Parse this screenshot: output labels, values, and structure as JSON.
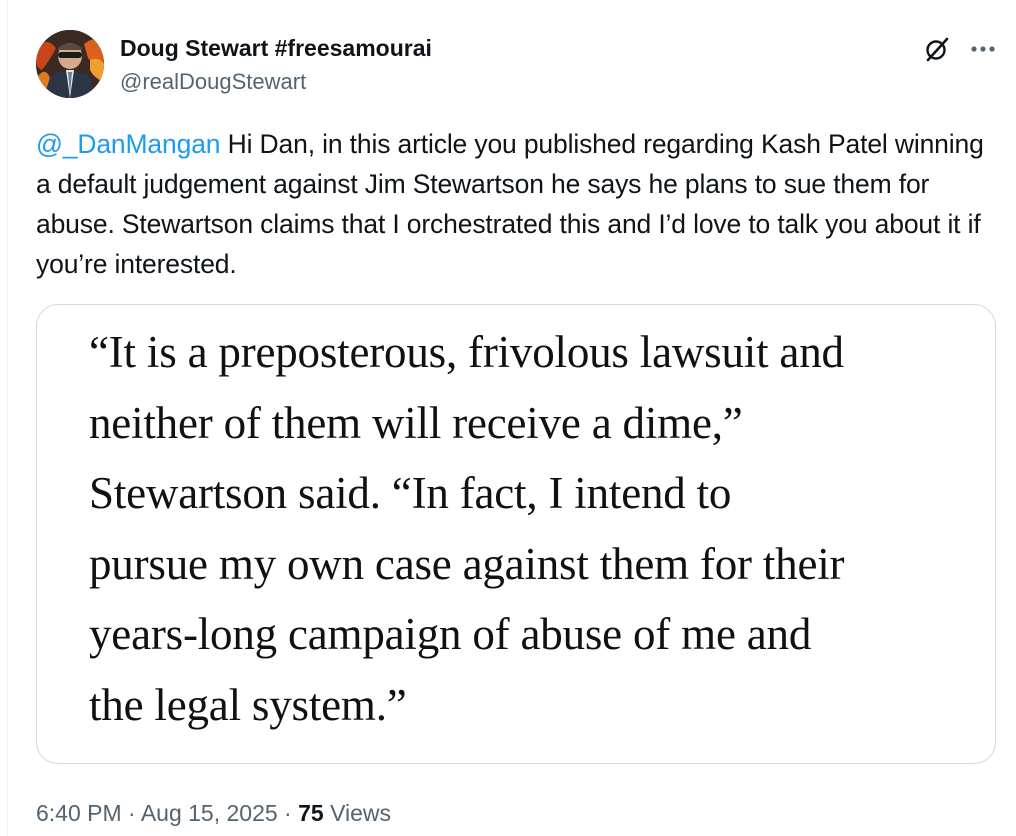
{
  "author": {
    "display_name": "Doug Stewart #freesamourai",
    "handle": "@realDougStewart"
  },
  "icons": {
    "grok": "grok-icon",
    "more": "more-icon"
  },
  "tweet": {
    "mention": "@_DanMangan",
    "text": " Hi Dan, in this article you published regarding Kash Patel winning a default judgement against Jim Stewartson he says he plans to sue them for abuse. Stewartson claims that I orchestrated this and I’d love to talk you about it if you’re interested."
  },
  "media": {
    "quote_lines": [
      "“It is a preposterous, frivolous lawsuit and",
      "neither of them will receive a dime,”",
      "Stewartson said. “In fact, I intend to",
      "pursue my own case against them for their",
      "years-long campaign of abuse of me and",
      "the legal system.”"
    ]
  },
  "meta": {
    "time": "6:40 PM",
    "separator": " · ",
    "date": "Aug 15, 2025",
    "views_count": "75",
    "views_label": " Views"
  },
  "colors": {
    "link": "#1d9bf0",
    "secondary_text": "#536471",
    "primary_text": "#0f1419",
    "card_border": "#cfd9de"
  }
}
